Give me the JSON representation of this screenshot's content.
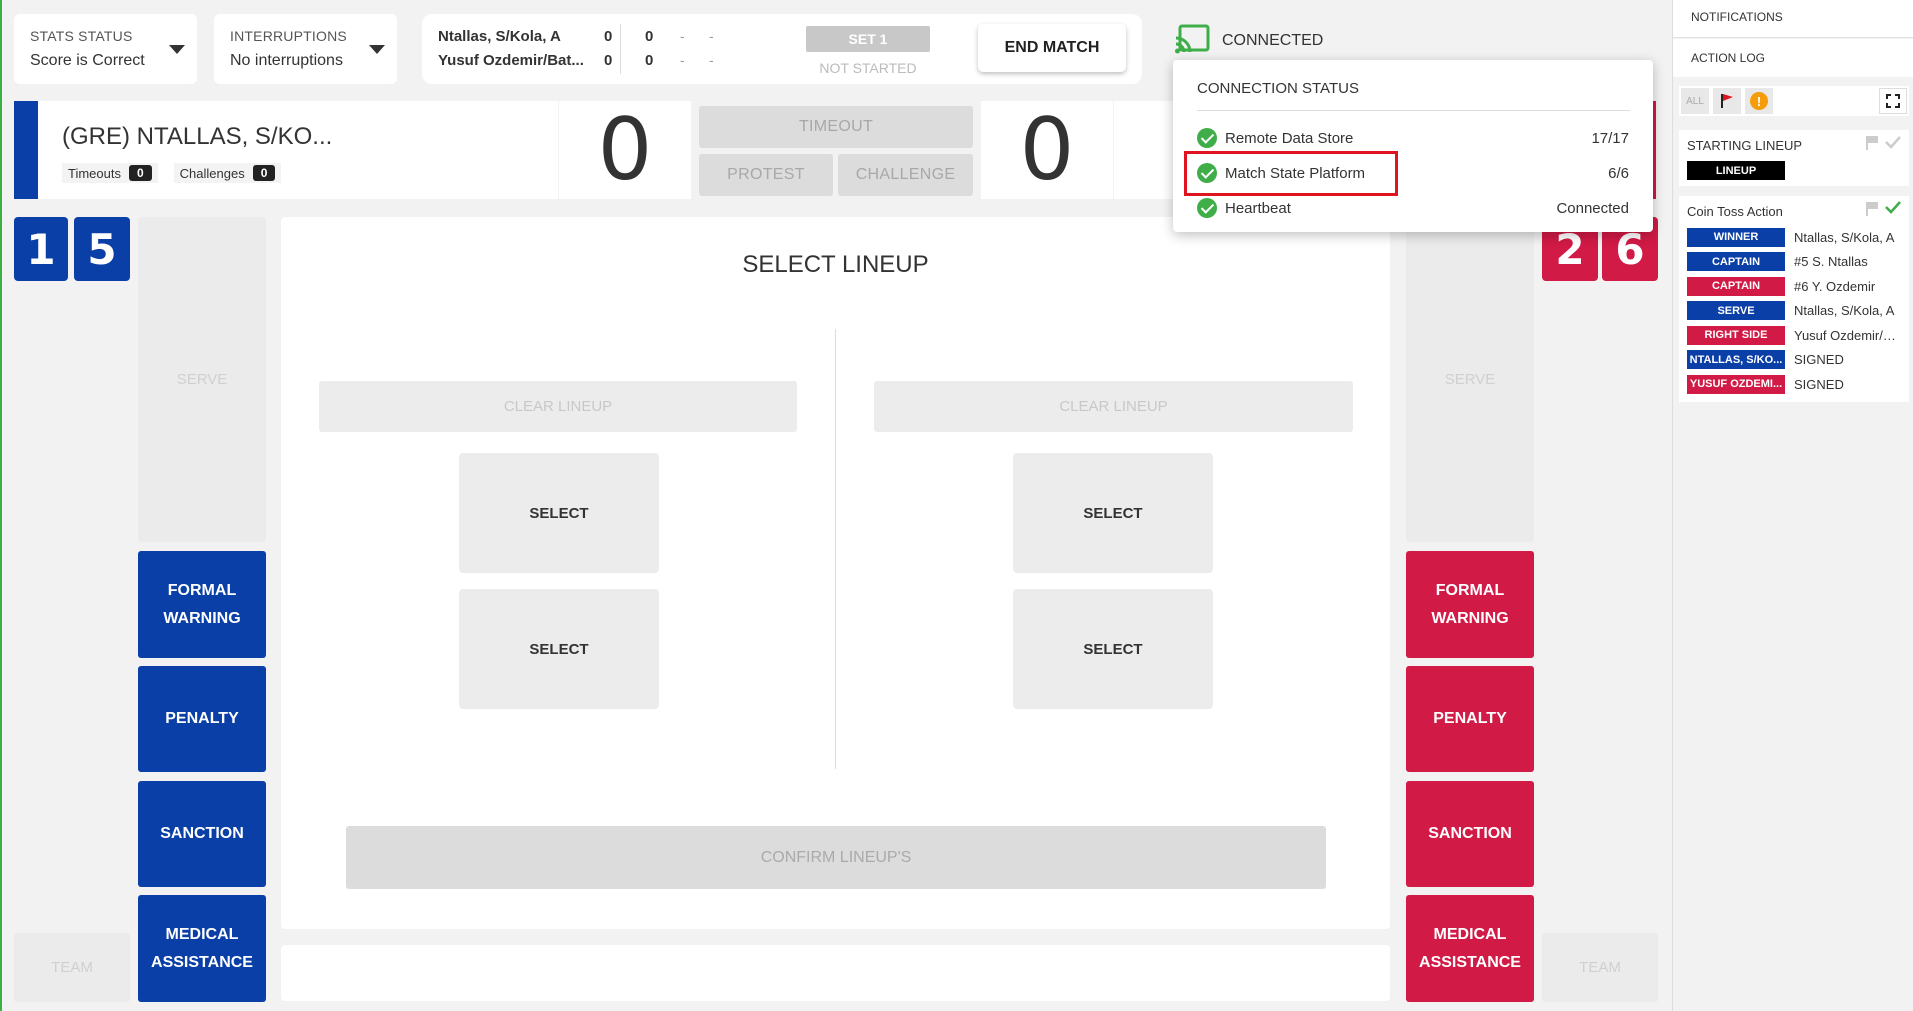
{
  "stats_status": {
    "label": "STATS STATUS",
    "value": "Score is Correct"
  },
  "interruptions": {
    "label": "INTERRUPTIONS",
    "value": "No interruptions"
  },
  "scoreboard": {
    "team_a": "Ntallas, S/Kola, A",
    "team_b": "Yusuf Ozdemir/Bat...",
    "a_sets": "0",
    "a_points": "0",
    "a_s1": "-",
    "a_s2": "-",
    "b_sets": "0",
    "b_points": "0",
    "b_s1": "-",
    "b_s2": "-",
    "set_label": "SET 1",
    "set_status": "NOT STARTED"
  },
  "end_match": "END MATCH",
  "connection": {
    "label": "CONNECTED",
    "popup_title": "CONNECTION STATUS",
    "rows": [
      {
        "name": "Remote Data Store",
        "value": "17/17"
      },
      {
        "name": "Match State Platform",
        "value": "6/6"
      },
      {
        "name": "Heartbeat",
        "value": "Connected"
      }
    ]
  },
  "team_left": {
    "name": "(GRE) NTALLAS, S/KO...",
    "timeouts_label": "Timeouts",
    "timeouts": "0",
    "challenges_label": "Challenges",
    "challenges": "0",
    "score": "0",
    "players": [
      "1",
      "5"
    ]
  },
  "team_right": {
    "score": "0",
    "players": [
      "2",
      "6"
    ]
  },
  "center_buttons": {
    "timeout": "TIMEOUT",
    "protest": "PROTEST",
    "challenge": "CHALLENGE"
  },
  "side_buttons": {
    "serve": "SERVE",
    "formal_warning": [
      "FORMAL",
      "WARNING"
    ],
    "penalty": "PENALTY",
    "sanction": "SANCTION",
    "medical": [
      "MEDICAL",
      "ASSISTANCE"
    ],
    "team": "TEAM"
  },
  "lineup": {
    "title": "SELECT LINEUP",
    "clear": "CLEAR LINEUP",
    "select": "SELECT",
    "confirm": "CONFIRM LINEUP'S"
  },
  "right_panel": {
    "notifications": "NOTIFICATIONS",
    "action_log": "ACTION LOG",
    "filter_all": "ALL",
    "starting_lineup": {
      "title": "STARTING LINEUP",
      "tag": "LINEUP"
    },
    "coin_toss": {
      "title": "Coin Toss Action",
      "rows": [
        {
          "tag": "WINNER",
          "color": "blue",
          "text": "Ntallas, S/Kola, A"
        },
        {
          "tag": "CAPTAIN",
          "color": "blue",
          "text": "#5 S. Ntallas"
        },
        {
          "tag": "CAPTAIN",
          "color": "red",
          "text": "#6 Y. Ozdemir"
        },
        {
          "tag": "SERVE",
          "color": "blue",
          "text": "Ntallas, S/Kola, A"
        },
        {
          "tag": "RIGHT SIDE",
          "color": "red",
          "text": "Yusuf Ozdemir/Ba..."
        },
        {
          "tag": "NTALLAS, S/KO...",
          "color": "blue",
          "text": "SIGNED"
        },
        {
          "tag": "YUSUF OZDEMI...",
          "color": "red",
          "text": "SIGNED"
        }
      ]
    }
  },
  "colors": {
    "blue": "#0a3fa8",
    "red": "#d11a45",
    "green": "#3fae49",
    "highlight": "#e0141e"
  }
}
